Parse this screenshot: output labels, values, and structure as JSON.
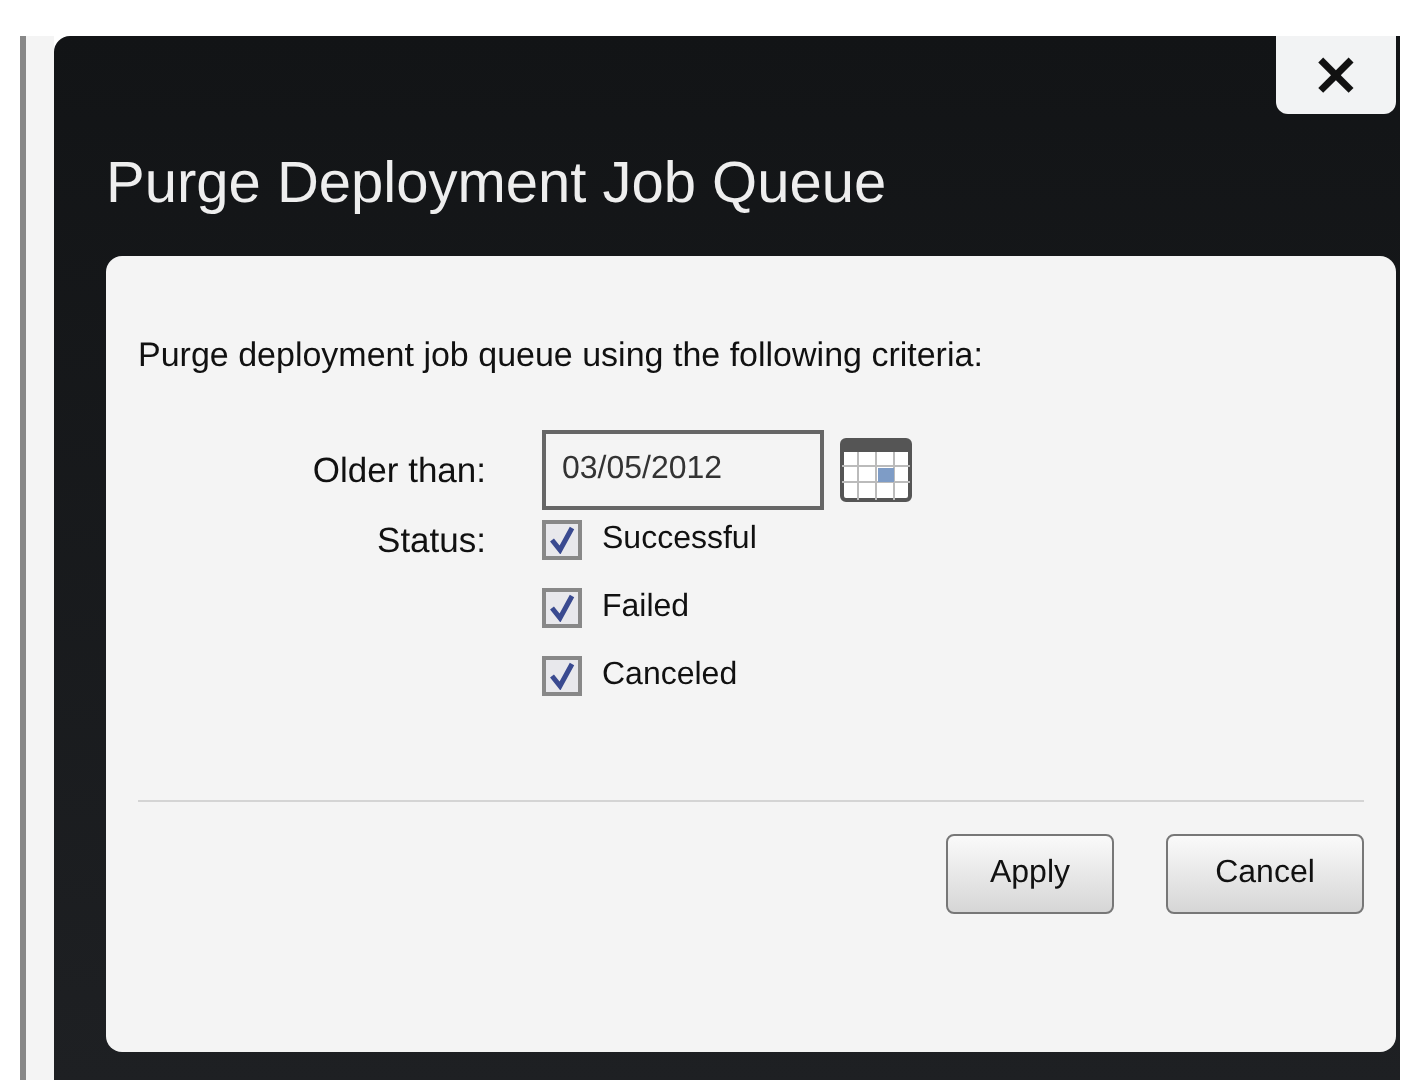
{
  "dialog": {
    "title": "Purge Deployment Job Queue",
    "close": "×"
  },
  "intro": "Purge deployment job queue using the following criteria:",
  "older_than": {
    "label": "Older than:",
    "value": "03/05/2012"
  },
  "status": {
    "label": "Status:",
    "options": [
      {
        "label": "Successful",
        "checked": true
      },
      {
        "label": "Failed",
        "checked": true
      },
      {
        "label": "Canceled",
        "checked": true
      }
    ]
  },
  "buttons": [
    "Apply",
    "Cancel"
  ]
}
